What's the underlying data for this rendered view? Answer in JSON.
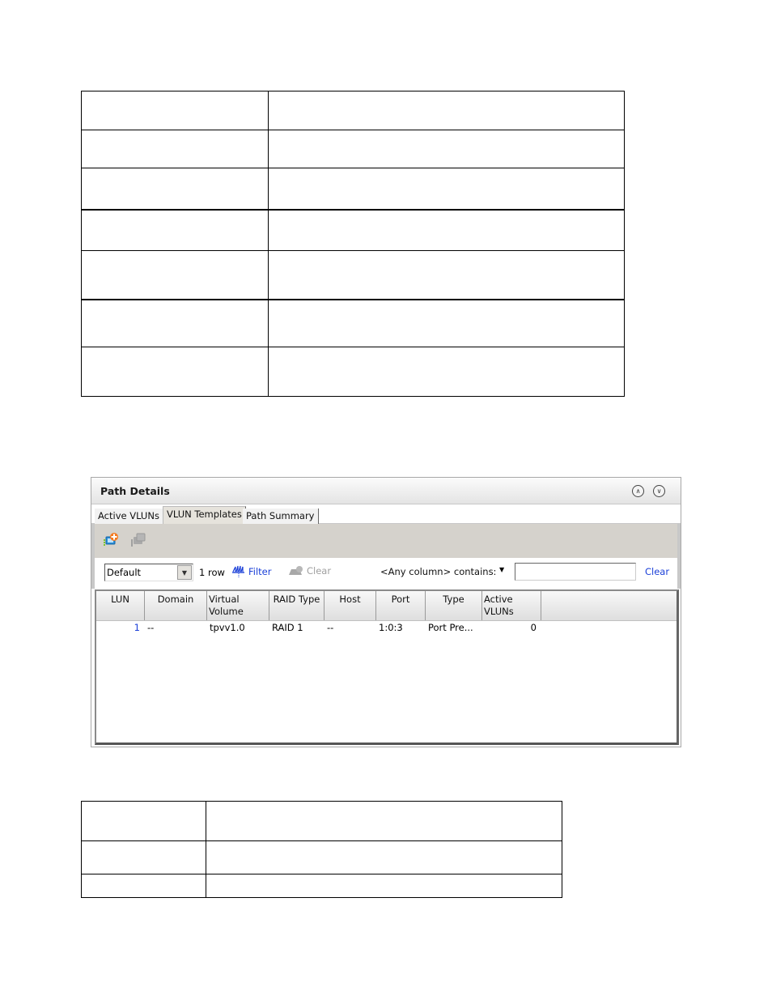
{
  "top_table": {
    "rows": [
      [
        "",
        ""
      ],
      [
        "",
        ""
      ],
      [
        "",
        ""
      ],
      [
        "",
        ""
      ],
      [
        "",
        ""
      ],
      [
        "",
        ""
      ],
      [
        "",
        ""
      ]
    ]
  },
  "panel": {
    "title": "Path Details",
    "header_buttons": {
      "collapse_icon": "double-chevron-up-icon",
      "expand_icon": "double-chevron-down-icon"
    },
    "tabs": [
      {
        "label": "Active VLUNs",
        "active": false
      },
      {
        "label": "VLUN Templates",
        "active": true
      },
      {
        "label": "Path Summary",
        "active": false
      }
    ],
    "toolbar": {
      "icons": [
        "add-vlun-template-icon",
        "remove-vlun-template-icon"
      ]
    },
    "filter_bar": {
      "view_select": "Default",
      "row_count": "1 row",
      "filter_label": "Filter",
      "clear_disabled_label": "Clear",
      "any_column_label": "<Any column> contains:",
      "search_value": "",
      "clear_label": "Clear"
    },
    "grid": {
      "columns": [
        "LUN",
        "Domain",
        "Virtual Volume",
        "RAID Type",
        "Host",
        "Port",
        "Type",
        "Active VLUNs"
      ],
      "column_lines": [
        [
          "LUN"
        ],
        [
          "Domain"
        ],
        [
          "Virtual",
          "Volume"
        ],
        [
          "RAID Type"
        ],
        [
          "Host"
        ],
        [
          "Port"
        ],
        [
          "Type"
        ],
        [
          "Active",
          "VLUNs"
        ]
      ],
      "rows": [
        {
          "lun": "1",
          "domain": "--",
          "virtual_volume": "tpvv1.0",
          "raid_type": "RAID 1",
          "host": "--",
          "port": "1:0:3",
          "type": "Port Pre...",
          "active_vluns": "0"
        }
      ]
    }
  },
  "bottom_table": {
    "rows": [
      [
        "",
        ""
      ],
      [
        "",
        ""
      ],
      [
        "",
        ""
      ]
    ]
  }
}
